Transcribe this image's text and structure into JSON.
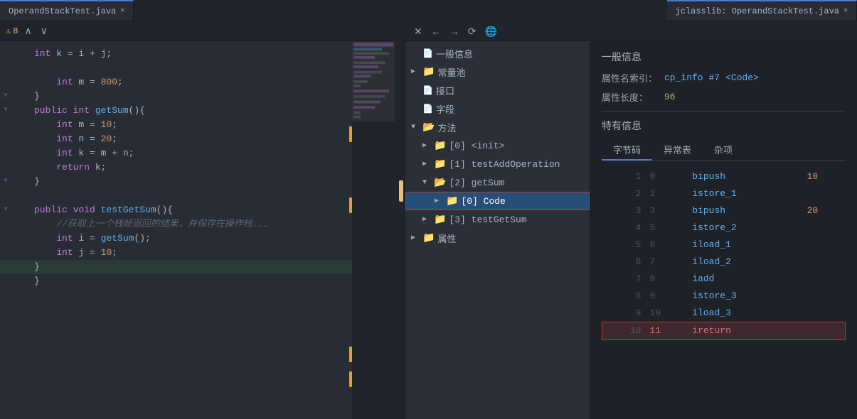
{
  "tabs": [
    {
      "label": "OperandStackTest.java",
      "active": true
    },
    {
      "label": "jclasslib: OperandStackTest.java",
      "active": true,
      "pane": "right"
    }
  ],
  "editor": {
    "warn_count": "8",
    "lines": [
      {
        "num": "",
        "indent": 0,
        "tokens": [
          {
            "t": "kw",
            "v": "int"
          },
          {
            "t": "op",
            "v": " k = i + j;"
          }
        ]
      },
      {
        "num": "",
        "indent": 0,
        "tokens": [
          {
            "t": "op",
            "v": ""
          }
        ]
      },
      {
        "num": "",
        "indent": 0,
        "tokens": [
          {
            "t": "kw",
            "v": "int"
          },
          {
            "t": "op",
            "v": " m = "
          },
          {
            "t": "num",
            "v": "800"
          },
          {
            "t": "op",
            "v": ";"
          }
        ]
      },
      {
        "num": "",
        "indent": 0,
        "tokens": [
          {
            "t": "op",
            "v": "}"
          }
        ]
      },
      {
        "num": "",
        "indent": 0,
        "tokens": [
          {
            "t": "kw",
            "v": "public"
          },
          {
            "t": "op",
            "v": " "
          },
          {
            "t": "kw",
            "v": "int"
          },
          {
            "t": "op",
            "v": " "
          },
          {
            "t": "fn",
            "v": "getSum"
          },
          {
            "t": "op",
            "v": "(){"
          }
        ]
      },
      {
        "num": "",
        "indent": 1,
        "tokens": [
          {
            "t": "kw",
            "v": "int"
          },
          {
            "t": "op",
            "v": " m = "
          },
          {
            "t": "num",
            "v": "10"
          },
          {
            "t": "op",
            "v": ";"
          }
        ]
      },
      {
        "num": "",
        "indent": 1,
        "tokens": [
          {
            "t": "kw",
            "v": "int"
          },
          {
            "t": "op",
            "v": " n = "
          },
          {
            "t": "num",
            "v": "20"
          },
          {
            "t": "op",
            "v": ";"
          }
        ]
      },
      {
        "num": "",
        "indent": 1,
        "tokens": [
          {
            "t": "kw",
            "v": "int"
          },
          {
            "t": "op",
            "v": " k = m + n;"
          }
        ]
      },
      {
        "num": "",
        "indent": 1,
        "tokens": [
          {
            "t": "kw",
            "v": "return"
          },
          {
            "t": "op",
            "v": " k;"
          }
        ]
      },
      {
        "num": "",
        "indent": 0,
        "tokens": [
          {
            "t": "op",
            "v": "}"
          }
        ]
      },
      {
        "num": "",
        "indent": 0,
        "tokens": [
          {
            "t": "op",
            "v": ""
          }
        ]
      },
      {
        "num": "",
        "indent": 0,
        "tokens": [
          {
            "t": "kw",
            "v": "public"
          },
          {
            "t": "op",
            "v": " "
          },
          {
            "t": "kw",
            "v": "void"
          },
          {
            "t": "op",
            "v": " "
          },
          {
            "t": "fn",
            "v": "testGetSum"
          },
          {
            "t": "op",
            "v": "(){"
          }
        ]
      },
      {
        "num": "",
        "indent": 1,
        "tokens": [
          {
            "t": "cm",
            "v": "//获取上一个栈帧返回的结果，并保存在操作栈..."
          }
        ]
      },
      {
        "num": "",
        "indent": 1,
        "tokens": [
          {
            "t": "kw",
            "v": "int"
          },
          {
            "t": "op",
            "v": " i = "
          },
          {
            "t": "fn",
            "v": "getSum"
          },
          {
            "t": "op",
            "v": "();"
          }
        ]
      },
      {
        "num": "",
        "indent": 1,
        "tokens": [
          {
            "t": "kw",
            "v": "int"
          },
          {
            "t": "op",
            "v": " j = "
          },
          {
            "t": "num",
            "v": "10"
          },
          {
            "t": "op",
            "v": ";"
          }
        ]
      },
      {
        "num": "",
        "indent": 0,
        "tokens": [
          {
            "t": "op",
            "v": "}"
          }
        ]
      },
      {
        "num": "",
        "indent": 0,
        "tokens": [
          {
            "t": "op",
            "v": "}"
          }
        ]
      }
    ]
  },
  "jclasslib": {
    "toolbar": {
      "close": "✕",
      "back": "←",
      "forward": "→",
      "refresh": "⟳",
      "web": "🌐"
    },
    "tree": [
      {
        "level": 0,
        "label": "一般信息",
        "arrow": "",
        "type": "file",
        "expanded": false
      },
      {
        "level": 0,
        "label": "常量池",
        "arrow": "▶",
        "type": "folder",
        "expanded": false
      },
      {
        "level": 0,
        "label": "接口",
        "arrow": "",
        "type": "file",
        "expanded": false
      },
      {
        "level": 0,
        "label": "字段",
        "arrow": "",
        "type": "file",
        "expanded": false
      },
      {
        "level": 0,
        "label": "方法",
        "arrow": "▼",
        "type": "folder",
        "expanded": true
      },
      {
        "level": 1,
        "label": "[0] <init>",
        "arrow": "▶",
        "type": "folder",
        "expanded": false
      },
      {
        "level": 1,
        "label": "[1] testAddOperation",
        "arrow": "▶",
        "type": "folder",
        "expanded": false
      },
      {
        "level": 1,
        "label": "[2] getSum",
        "arrow": "▼",
        "type": "folder",
        "expanded": true
      },
      {
        "level": 2,
        "label": "[0] Code",
        "arrow": "▶",
        "type": "folder",
        "expanded": false,
        "selected": true
      },
      {
        "level": 1,
        "label": "[3] testGetSum",
        "arrow": "▶",
        "type": "folder",
        "expanded": false
      },
      {
        "level": 0,
        "label": "属性",
        "arrow": "▶",
        "type": "folder",
        "expanded": false
      }
    ],
    "info": {
      "general_title": "一般信息",
      "attr_name_label": "属性名索引：",
      "attr_name_value": "cp_info #7",
      "attr_name_link": "<Code>",
      "attr_len_label": "属性长度：",
      "attr_len_value": "96",
      "special_title": "特有信息",
      "tabs": [
        "字节码",
        "异常表",
        "杂项"
      ],
      "active_tab": "字节码",
      "bytecode": [
        {
          "line": 1,
          "offset": "0",
          "instr": "bipush",
          "arg": "10"
        },
        {
          "line": 2,
          "offset": "2",
          "instr": "istore_1",
          "arg": ""
        },
        {
          "line": 3,
          "offset": "3",
          "instr": "bipush",
          "arg": "20"
        },
        {
          "line": 4,
          "offset": "5",
          "instr": "istore_2",
          "arg": ""
        },
        {
          "line": 5,
          "offset": "6",
          "instr": "iload_1",
          "arg": ""
        },
        {
          "line": 6,
          "offset": "7",
          "instr": "iload_2",
          "arg": ""
        },
        {
          "line": 7,
          "offset": "8",
          "instr": "iadd",
          "arg": ""
        },
        {
          "line": 8,
          "offset": "9",
          "instr": "istore_3",
          "arg": ""
        },
        {
          "line": 9,
          "offset": "10",
          "instr": "iload_3",
          "arg": ""
        },
        {
          "line": 10,
          "offset": "11",
          "instr": "ireturn",
          "arg": "",
          "highlighted": true
        }
      ]
    }
  }
}
